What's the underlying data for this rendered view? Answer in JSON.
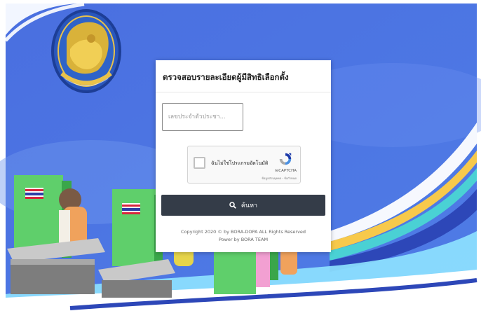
{
  "card": {
    "title": "ตรวจสอบรายละเอียดผู้มีสิทธิเลือกตั้ง",
    "id_placeholder": "เลขประจำตัวประชา..."
  },
  "captcha": {
    "label": "ฉันไม่ใช่โปรแกรมอัตโนมัติ",
    "brand": "reCAPTCHA",
    "terms": "ข้อมูลส่วนบุคคล - ข้อกำหนด"
  },
  "search": {
    "label": "ค้นหา",
    "icon": "search-icon"
  },
  "footer": {
    "copyright": "Copyright 2020 © by BORA-DOPA ALL Rights Reserved",
    "powered": "Power by BORA TEAM"
  },
  "colors": {
    "sky": "#4f77e0",
    "button": "#343c48",
    "ballot_green": "#5fcf6b"
  },
  "icons": [
    "seal-emblem",
    "recaptcha-logo-icon",
    "search-icon",
    "thai-flag-icon"
  ]
}
